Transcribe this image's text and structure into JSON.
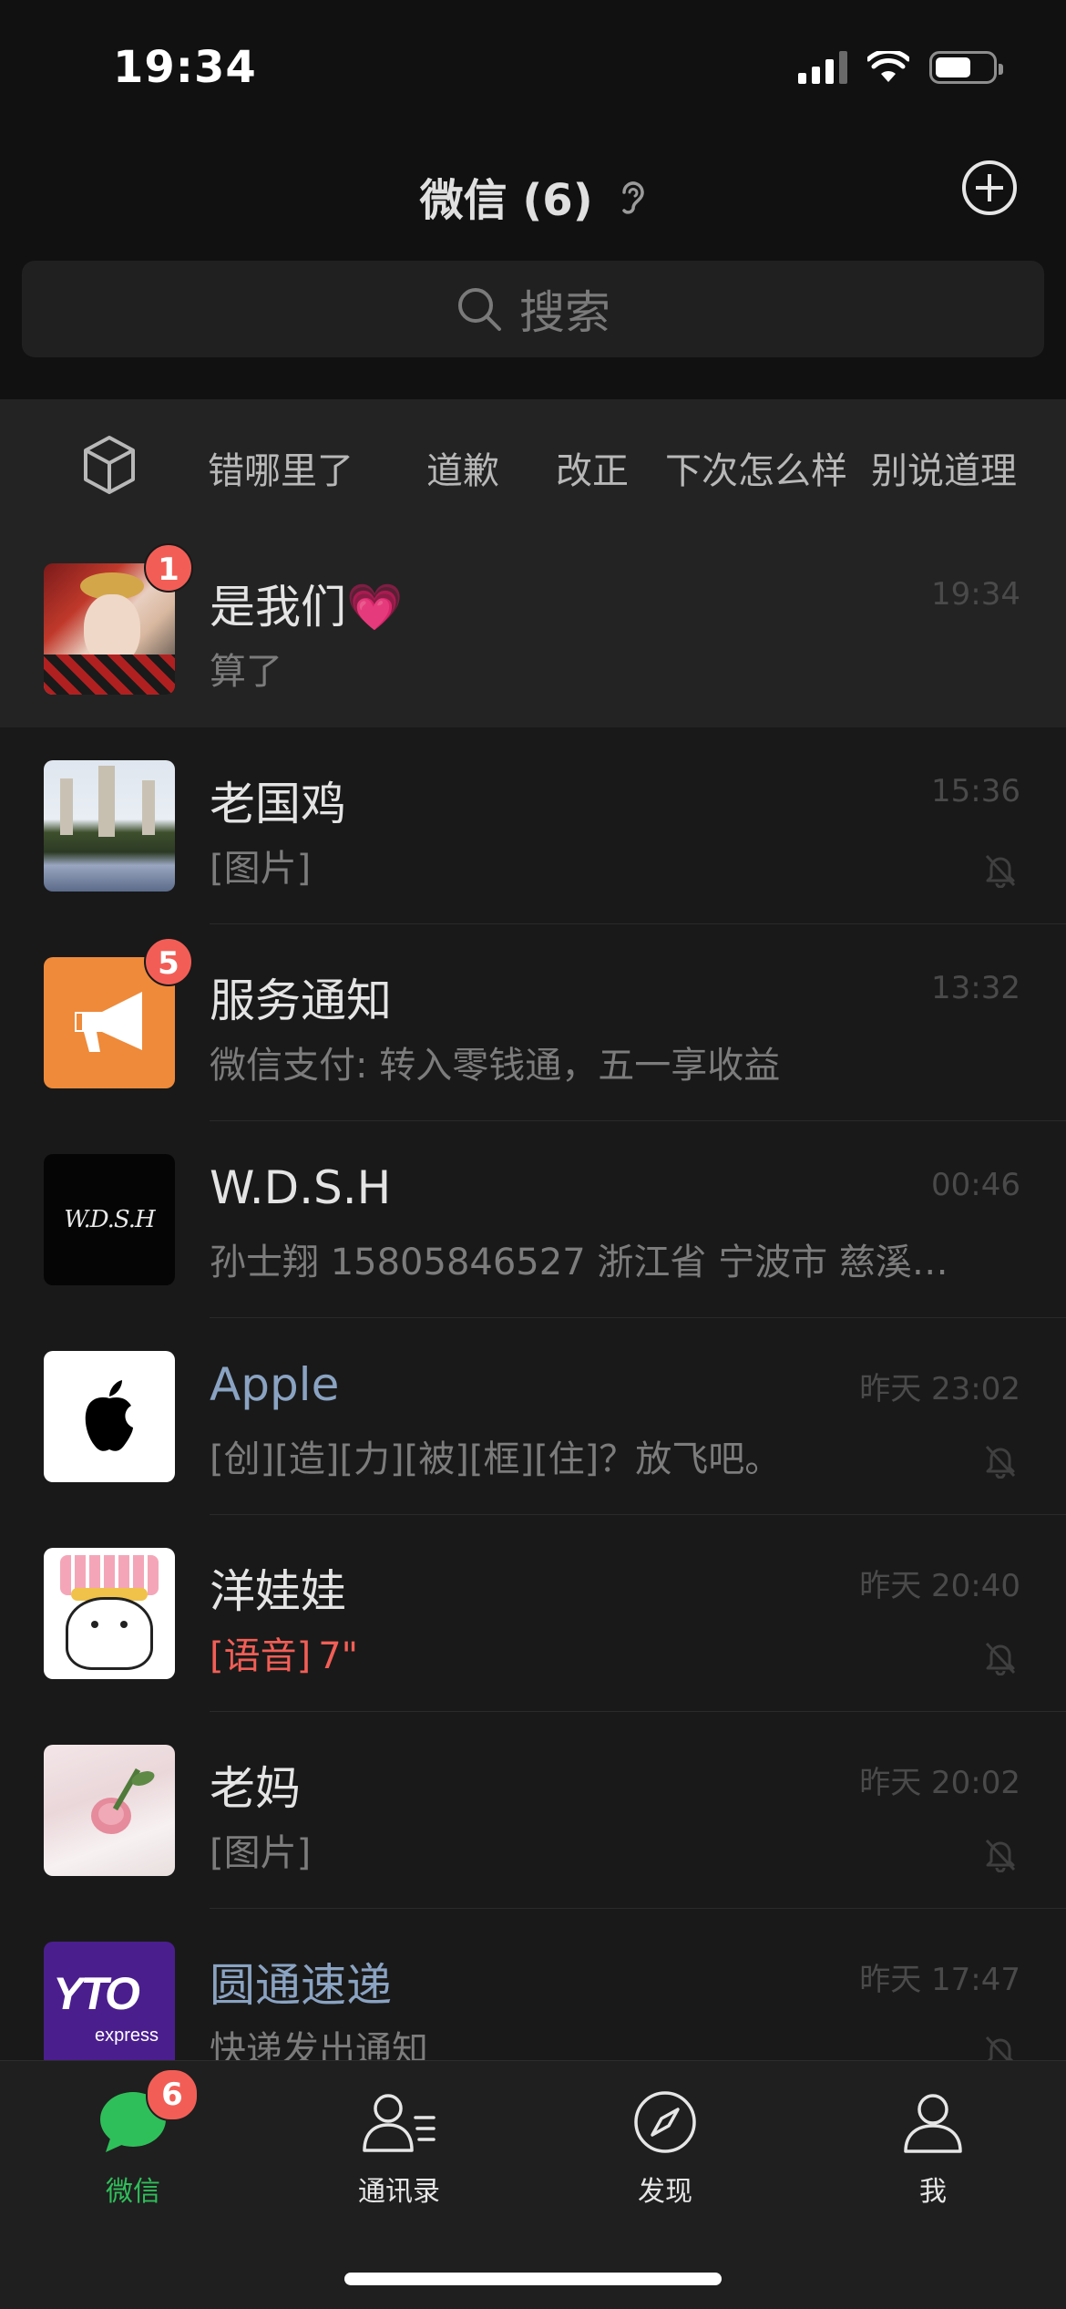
{
  "status_bar": {
    "time": "19:34"
  },
  "header": {
    "title": "微信 (6)"
  },
  "search": {
    "placeholder": "搜索"
  },
  "tags": [
    "错哪里了",
    "道歉",
    "改正",
    "下次怎么样",
    "别说道理"
  ],
  "chats": [
    {
      "name": "是我们💗",
      "message": "算了",
      "time": "19:34",
      "badge": "1",
      "muted": false
    },
    {
      "name": "老国鸡",
      "message": "[图片]",
      "time": "15:36",
      "muted": true
    },
    {
      "name": "服务通知",
      "message": "微信支付: 转入零钱通，五一享收益",
      "time": "13:32",
      "badge": "5",
      "muted": false
    },
    {
      "name": "W.D.S.H",
      "message": "孙士翔 15805846527  浙江省 宁波市 慈溪…",
      "time": "00:46",
      "avatar_text": "W.D.S.H",
      "muted": false
    },
    {
      "name": "Apple",
      "message": "[创][造][力][被][框][住]？放飞吧。",
      "time": "昨天 23:02",
      "muted": true
    },
    {
      "name": "洋娃娃",
      "message_tag": "[语音]",
      "message_value": "7\"",
      "time": "昨天 20:40",
      "muted": true
    },
    {
      "name": "老妈",
      "message": "[图片]",
      "time": "昨天 20:02",
      "muted": true
    },
    {
      "name": "圆通速递",
      "message": "快递发出通知",
      "time": "昨天 17:47",
      "avatar_text": "YTO",
      "avatar_subtext": "express",
      "muted": true
    }
  ],
  "tab_bar": {
    "items": [
      {
        "label": "微信",
        "badge": "6",
        "icon": "chat-bubble-icon"
      },
      {
        "label": "通讯录",
        "icon": "contacts-icon"
      },
      {
        "label": "发现",
        "icon": "compass-icon"
      },
      {
        "label": "我",
        "icon": "person-icon"
      }
    ]
  },
  "colors": {
    "accent_green": "#2fbf5a",
    "badge_red": "#f25e56",
    "background": "#191919"
  }
}
